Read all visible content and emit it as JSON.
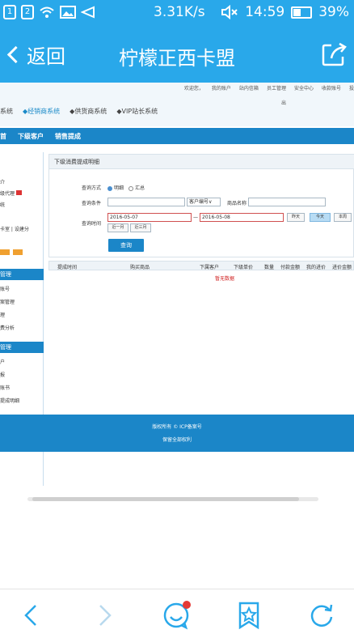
{
  "status_bar": {
    "sim1": "1",
    "sim2": "2",
    "speed": "3.31K/s",
    "time": "14:59",
    "battery": "39%"
  },
  "nav": {
    "back_label": "返回",
    "title": "柠檬正西卡盟"
  },
  "web": {
    "top_links": [
      "欢迎您，",
      "我的账户",
      "站内信箱",
      "员工管理",
      "安全中心",
      "收款账号",
      "投"
    ],
    "top_sub": "出",
    "system_tabs": [
      "系统",
      "经销商系统",
      "供货商系统",
      "VIP站长系统"
    ],
    "blue_nav": [
      "首",
      "下级客户",
      "销售提成"
    ],
    "sidebar": {
      "items_top": [
        "介",
        "级代理",
        "统"
      ],
      "links": [
        "卡室",
        "设建分"
      ],
      "head1": "管理",
      "items_mid": [
        "账号",
        "案管理",
        "理",
        "费分析"
      ],
      "head2": "管理",
      "items_bot": [
        "户",
        "报",
        "账书",
        "提成明细"
      ]
    },
    "panel_title": "下级消费提成明细",
    "form": {
      "mode_label": "查询方式",
      "mode_options": [
        "明细",
        "汇总"
      ],
      "cond_label": "查询条件",
      "customer_select": "客户编号",
      "product_label": "商品名称",
      "time_label": "查询时间",
      "date_from": "2016-05-07",
      "date_to": "2016-05-08",
      "quick": [
        "昨天",
        "今天",
        "本周"
      ],
      "quick2": [
        "近一月",
        "近三月"
      ],
      "query_button": "查询"
    },
    "table_headers": [
      "提成时间",
      "购买商品",
      "下属客户",
      "下级单价",
      "数量",
      "付款金额",
      "我的进价",
      "进价金额"
    ],
    "no_data": "暂无数据",
    "footer": {
      "line1": "版权所有 © ICP备案号",
      "line2": "保留全部权利"
    }
  },
  "bottom_bar": {
    "icons": [
      "back-icon",
      "forward-icon",
      "chat-icon",
      "bookmark-icon",
      "refresh-icon"
    ],
    "badge_color": "#e53935"
  },
  "colors": {
    "header_blue": "#29a8ea",
    "site_blue": "#1b86c8"
  }
}
